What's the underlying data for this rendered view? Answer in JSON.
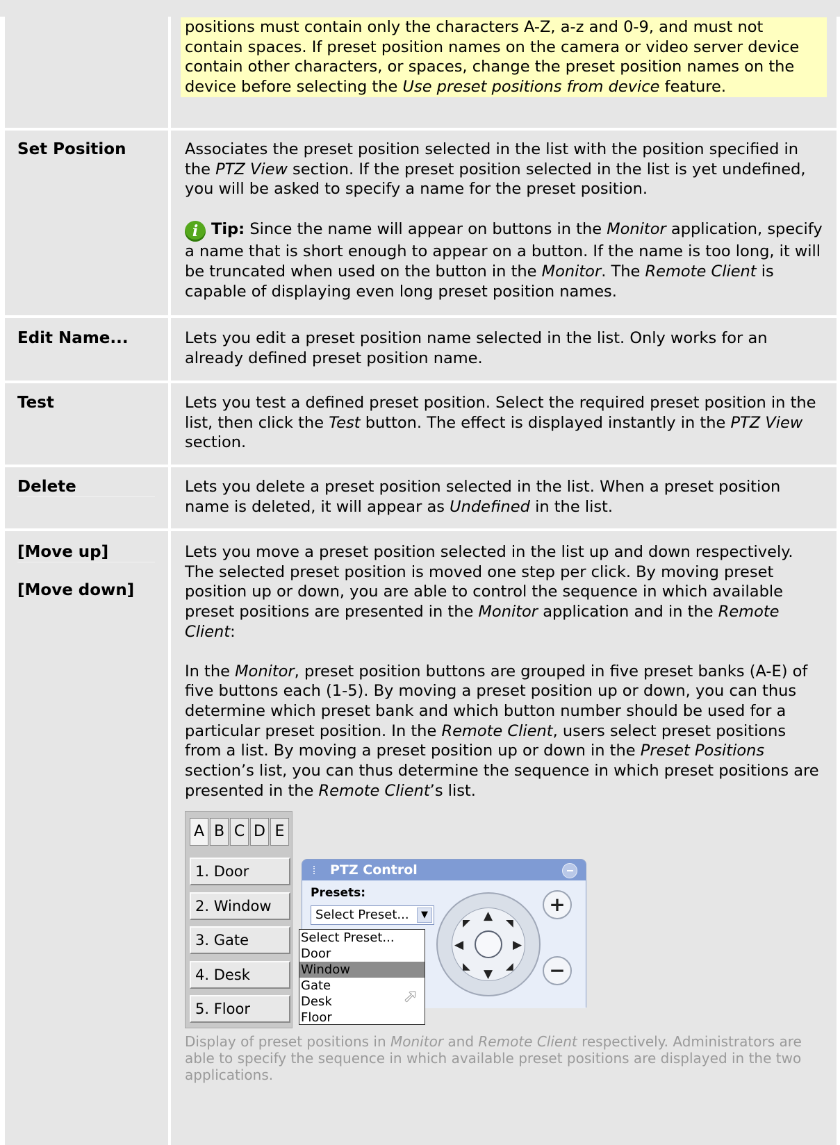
{
  "intro_note": {
    "text_1": "positions must contain only the characters A-Z, a-z and 0-9, and must not contain spaces. If preset position names on the camera or video server device contain other characters, or spaces, change the preset position names on the device before selecting the ",
    "text_italic": "Use preset positions from device",
    "text_2": " feature."
  },
  "set_position": {
    "term": "Set Position",
    "d1": "Associates the preset position selected in the list with the position specified in the ",
    "d1_i": "PTZ View",
    "d1_b": " section. If the preset position selected in the list is yet undefined, you will be asked to specify a name for the preset position.",
    "tip_label": "Tip:",
    "tip_1": " Since the name will appear on buttons in the ",
    "tip_i1": "Monitor",
    "tip_2": " application, specify a name that is short enough to appear on a button. If the name is too long, it will be truncated when used on the button in the ",
    "tip_i2": "Monitor",
    "tip_3": ". The ",
    "tip_i3": "Remote Client",
    "tip_4": " is capable of displaying even long preset position names."
  },
  "edit_name": {
    "term": "Edit Name...",
    "desc": "Lets you edit a preset position name selected in the list. Only works for an already defined preset position name."
  },
  "test": {
    "term": "Test",
    "d1": "Lets you test a defined preset position. Select the required preset position in the list, then click the ",
    "d1_i": "Test",
    "d1_b": " button. The effect is displayed instantly in the ",
    "d1_i2": "PTZ View",
    "d1_c": " section."
  },
  "delete": {
    "term": "Delete",
    "d1": "Lets you delete a preset position selected in the list. When a preset position name is deleted, it will appear as ",
    "d1_i": "Undefined",
    "d1_b": " in the list."
  },
  "move": {
    "term_up": "[Move up]",
    "term_down": "[Move down]",
    "p1_a": "Lets you move a preset position selected in the list up and down respectively. The selected preset position is moved one step per click. By moving preset position up or down, you are able to control the sequence in which available preset positions are presented in the ",
    "p1_i1": "Monitor",
    "p1_b": " application and in the ",
    "p1_i2": "Remote Client",
    "p1_c": ":",
    "p2_a": "In the ",
    "p2_i1": "Monitor",
    "p2_b": ", preset position buttons are grouped in five preset banks (A-E) of five buttons each (1-5). By moving a preset position up or down, you can thus determine which preset bank and which button number should be used for a particular preset position. In the ",
    "p2_i2": "Remote Client",
    "p2_c": ", users select preset positions from a list. By moving a preset position up or down in the ",
    "p2_i3": "Preset Positions",
    "p2_d": " section’s list, you can thus determine the sequence in which preset positions are presented in the ",
    "p2_i4": "Remote Client",
    "p2_e": "’s list.",
    "caption_a": "Display of preset positions in ",
    "caption_i1": "Monitor",
    "caption_b": " and ",
    "caption_i2": "Remote Client",
    "caption_c": " respectively. Administrators are able to specify the sequence in which available preset positions are displayed in the two applications."
  },
  "figure": {
    "bank_tabs": [
      "A",
      "B",
      "C",
      "D",
      "E"
    ],
    "buttons": [
      "1. Door",
      "2. Window",
      "3. Gate",
      "4. Desk",
      "5. Floor"
    ],
    "ptz_title": "PTZ Control",
    "presets_label": "Presets:",
    "select_value": "Select Preset...",
    "dropdown": [
      "Select Preset...",
      "Door",
      "Window",
      "Gate",
      "Desk",
      "Floor"
    ],
    "dropdown_selected": "Window"
  },
  "colors": {
    "row_bg": "#e6e6e6",
    "note_bg": "#ffffc0",
    "caption": "#9a9a9a",
    "tip_icon": "#55a81c"
  }
}
